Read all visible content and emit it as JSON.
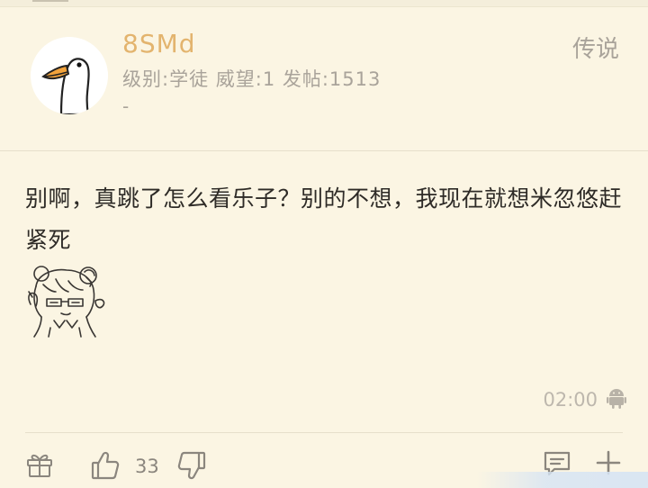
{
  "post": {
    "author": {
      "username": "8SMd",
      "meta": "级别:学徒 威望:1 发帖:1513",
      "signature": "-"
    },
    "floor_label": "传说",
    "content": "别啊，真跳了怎么看乐子？别的不想，我现在就想米忽悠赶紧死",
    "time": "02:00",
    "likes": "33"
  },
  "icons": {
    "avatar": "goose-avatar",
    "sticker": "anime-girl-sticker",
    "device": "android-icon",
    "gift": "gift-icon",
    "like": "thumbs-up-icon",
    "dislike": "thumbs-down-icon",
    "comment": "comment-icon",
    "add": "plus-icon"
  },
  "colors": {
    "background": "#fbf5e3",
    "username": "#e3b46e",
    "meta": "#a9a39a",
    "text": "#2e2b27"
  }
}
